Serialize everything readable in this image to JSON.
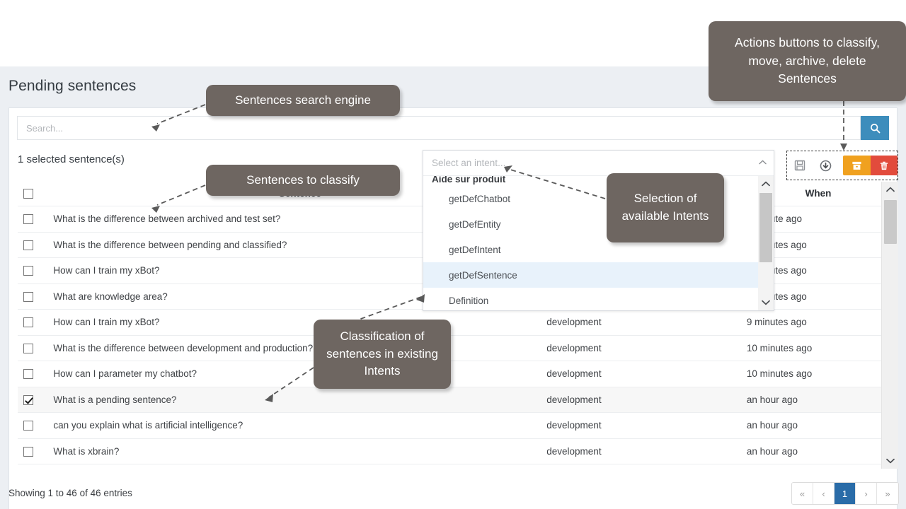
{
  "page": {
    "title": "Pending sentences",
    "selected_count_label": "1 selected sentence(s)",
    "footer_note": "Showing 1 to 46 of 46 entries"
  },
  "search": {
    "placeholder": "Search...",
    "value": "",
    "button_icon": "search-icon"
  },
  "actions": {
    "save": {
      "label": "",
      "icon": "save-icon"
    },
    "move": {
      "label": "",
      "icon": "move-down-circle-icon"
    },
    "archive": {
      "label": "",
      "icon": "archive-box-icon",
      "color": "#f0a11f"
    },
    "delete": {
      "label": "",
      "icon": "trash-icon",
      "color": "#e24b3c"
    }
  },
  "table": {
    "headers": {
      "sentence": "Sentence",
      "environment": "",
      "when": "When"
    },
    "rows": [
      {
        "sentence": "What is the difference between archived and test set?",
        "environment": "",
        "when": "a minute ago",
        "checked": false
      },
      {
        "sentence": "What is the difference between pending and classified?",
        "environment": "",
        "when": "2 minutes ago",
        "checked": false
      },
      {
        "sentence": "How can I train my xBot?",
        "environment": "",
        "when": "6 minutes ago",
        "checked": false
      },
      {
        "sentence": "What are knowledge area?",
        "environment": "",
        "when": "9 minutes ago",
        "checked": false
      },
      {
        "sentence": "How can I train my xBot?",
        "environment": "development",
        "when": "9 minutes ago",
        "checked": false
      },
      {
        "sentence": "What is the difference between development and production?",
        "environment": "development",
        "when": "10 minutes ago",
        "checked": false
      },
      {
        "sentence": "How can I parameter my chatbot?",
        "environment": "development",
        "when": "10 minutes ago",
        "checked": false
      },
      {
        "sentence": "What is a pending sentence?",
        "environment": "development",
        "when": "an hour ago",
        "checked": true
      },
      {
        "sentence": "can you explain what is artificial intelligence?",
        "environment": "development",
        "when": "an hour ago",
        "checked": false
      },
      {
        "sentence": "What is xbrain?",
        "environment": "development",
        "when": "an hour ago",
        "checked": false
      }
    ]
  },
  "intent_dropdown": {
    "placeholder": "Select an intent...",
    "group_label": "Aide sur produit",
    "options": [
      {
        "label": "getDefChatbot",
        "highlighted": false
      },
      {
        "label": "getDefEntity",
        "highlighted": false
      },
      {
        "label": "getDefIntent",
        "highlighted": false
      },
      {
        "label": "getDefSentence",
        "highlighted": true
      },
      {
        "label": "Definition",
        "highlighted": false
      }
    ]
  },
  "pagination": {
    "first": "«",
    "prev": "‹",
    "pages": [
      "1"
    ],
    "next": "›",
    "last": "»",
    "active": "1"
  },
  "callouts": {
    "actions": "Actions buttons to classify, move, archive, delete Sentences",
    "search": "Sentences search engine",
    "classify": "Sentences to classify",
    "intents": "Selection of available Intents",
    "existing": "Classification of sentences in existing Intents"
  },
  "colors": {
    "accent_blue": "#3d8dbc",
    "page_active_blue": "#2a6ca8",
    "archive_orange": "#f0a11f",
    "delete_red": "#e24b3c",
    "callout_gray": "#6e6661",
    "page_background": "#eceff3"
  }
}
